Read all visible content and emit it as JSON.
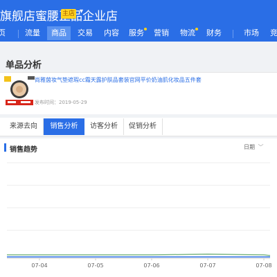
{
  "shop": {
    "name": "旗舰店蜜腰正品企业店",
    "badge": "主店",
    "caret": "▾"
  },
  "nav": {
    "items": [
      {
        "label": "首页",
        "key": "home"
      },
      {
        "label": "流量",
        "key": "traffic"
      },
      {
        "label": "商品",
        "key": "goods"
      },
      {
        "label": "交易",
        "key": "trade"
      },
      {
        "label": "内容",
        "key": "content"
      },
      {
        "label": "服务",
        "key": "service"
      },
      {
        "label": "营销",
        "key": "marketing"
      },
      {
        "label": "物流",
        "key": "logistics"
      },
      {
        "label": "财务",
        "key": "finance"
      },
      {
        "label": "市场",
        "key": "market"
      },
      {
        "label": "竞争",
        "key": "competition"
      }
    ],
    "active": "商品"
  },
  "page": {
    "title": "单品分析"
  },
  "product": {
    "title": "尚雅茵妆气垫遮瑕cc霜天露护肤品套装官网平价奶油肌化妆品五件套",
    "published": "发布时间：2019-05-29"
  },
  "tabs": [
    {
      "label": "来源去向"
    },
    {
      "label": "销售分析"
    },
    {
      "label": "访客分析"
    },
    {
      "label": "促销分析"
    }
  ],
  "section": {
    "title": "销售趋势",
    "range_label": "日期",
    "range_caret": "﹀"
  },
  "chart_data": {
    "type": "line",
    "x": [
      "07-04",
      "07-05",
      "07-06",
      "07-07",
      "07-08"
    ],
    "series": [
      {
        "values": [
          0,
          0,
          0,
          0,
          0
        ],
        "color": "#7fb885"
      },
      {
        "values": [
          0,
          0,
          0,
          0,
          0
        ],
        "color": "#2a6ee6"
      }
    ],
    "grid": true
  },
  "colors": {
    "brand": "#2a6ee6",
    "badge": "#ffd21f"
  }
}
